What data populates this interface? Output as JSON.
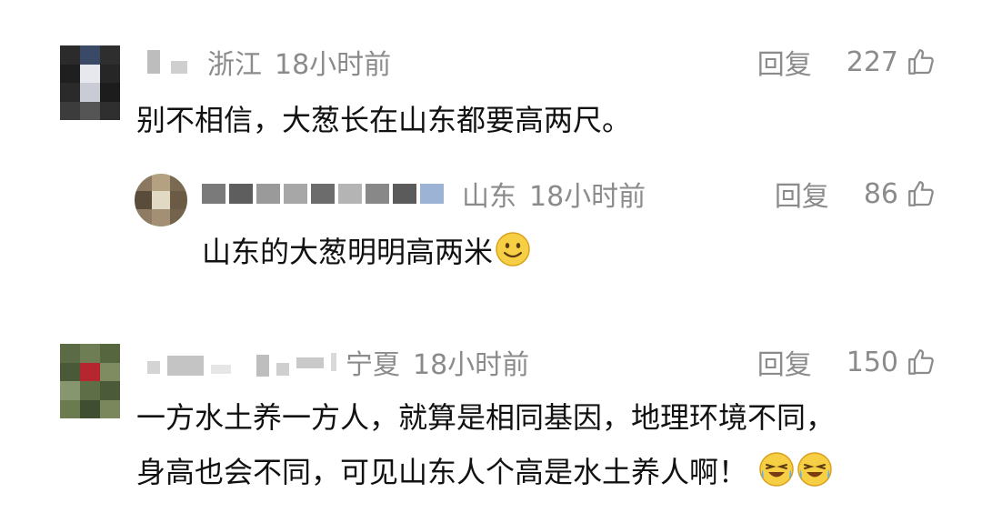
{
  "comments": [
    {
      "location": "浙江",
      "time": "18小时前",
      "reply_label": "回复",
      "likes": "227",
      "text": "别不相信，大葱长在山东都要高两尺。",
      "replies": [
        {
          "location": "山东",
          "time": "18小时前",
          "reply_label": "回复",
          "likes": "86",
          "text": "山东的大葱明明高两米",
          "emoji": "smile-emoji"
        }
      ]
    },
    {
      "location": "宁夏",
      "time": "18小时前",
      "reply_label": "回复",
      "likes": "150",
      "text_line1": "一方水土养一方人，就算是相同基因，地理环境不同，",
      "text_line2": "身高也会不同，可见山东人个高是水土养人啊！",
      "emoji": "laugh-cry-emoji"
    }
  ],
  "icons": {
    "like": "thumbs-up-icon"
  },
  "colors": {
    "meta_text": "#8b8b8b",
    "body_text": "#111111",
    "background": "#ffffff"
  }
}
